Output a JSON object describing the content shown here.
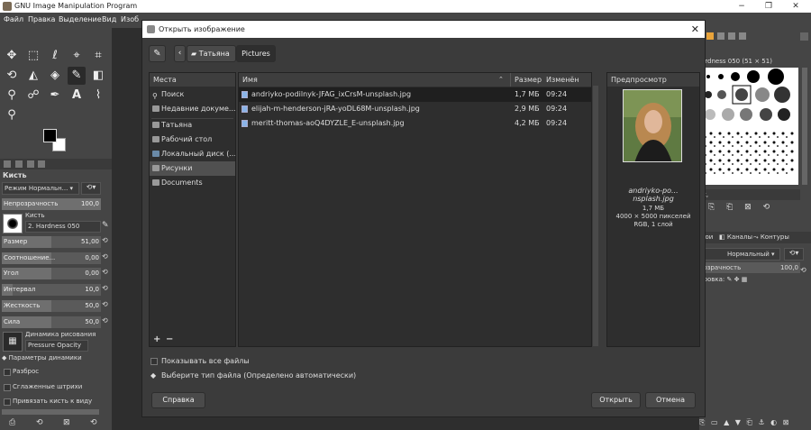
{
  "window": {
    "title": "GNU Image Manipulation Program",
    "minimize": "−",
    "restore": "❐",
    "close": "✕"
  },
  "menubar": [
    "Файл",
    "Правка",
    "Выделение",
    "Вид",
    "Изоб"
  ],
  "toolbox": {
    "brush_header": "Кисть",
    "mode_label": "Режим",
    "mode_value": "Нормальн...",
    "opacity_label": "Непрозрачность",
    "opacity_value": "100,0",
    "brush_label": "Кисть",
    "brush_value": "2. Hardness 050",
    "params": [
      {
        "label": "Размер",
        "value": "51,00"
      },
      {
        "label": "Соотношение...",
        "value": "0,00"
      },
      {
        "label": "Угол",
        "value": "0,00"
      },
      {
        "label": "Интервал",
        "value": "10,0"
      },
      {
        "label": "Жесткость",
        "value": "50,0"
      },
      {
        "label": "Сила",
        "value": "50,0"
      }
    ],
    "dynamics_label": "Динамика рисования",
    "dynamics_value": "Pressure Opacity",
    "dynamics_options": "Параметры динамики",
    "jitter": "Разброс",
    "smooth": "Сглаженные штрихи",
    "lock_brush": "Привязать кисть к виду"
  },
  "rightdock": {
    "brush_hint": "ardness 050 (51 × 51)",
    "filter_hint": "с,",
    "channels_tab": "Каналы",
    "paths_tab": "Контуры",
    "layers_tab": "лои",
    "mode_value": "Нормальный",
    "opacity_label": "розрачность",
    "opacity_value": "100,0",
    "lock_label": "ировка:"
  },
  "dialog": {
    "title": "Открыть изображение",
    "close": "✕",
    "path": [
      "Татьяна",
      "Pictures"
    ],
    "places_header": "Места",
    "places": [
      "Поиск",
      "Недавние докуме...",
      "Татьяна",
      "Рабочий стол",
      "Локальный диск (...",
      "Рисунки",
      "Documents"
    ],
    "columns": {
      "name": "Имя",
      "size": "Размер",
      "modified": "Изменён"
    },
    "files": [
      {
        "name": "andriyko-podilnyk-JFAG_ixCrsM-unsplash.jpg",
        "size": "1,7 МБ",
        "date": "09:24"
      },
      {
        "name": "elijah-m-henderson-jRA-yoDL68M-unsplash.jpg",
        "size": "2,9 МБ",
        "date": "09:24"
      },
      {
        "name": "meritt-thomas-aoQ4DYZLE_E-unsplash.jpg",
        "size": "4,2 МБ",
        "date": "09:24"
      }
    ],
    "preview_header": "Предпросмотр",
    "preview_name": "andriyko-po... nsplash.jpg",
    "preview_size": "1,7 МБ",
    "preview_dims": "4000 × 5000 пикселей",
    "preview_layers": "RGB, 1 слой",
    "add_place": "+",
    "remove_place": "−",
    "show_all": "Показывать все файлы",
    "file_type": "Выберите тип файла (Определено автоматически)",
    "help": "Справка",
    "open": "Открыть",
    "cancel": "Отмена"
  }
}
